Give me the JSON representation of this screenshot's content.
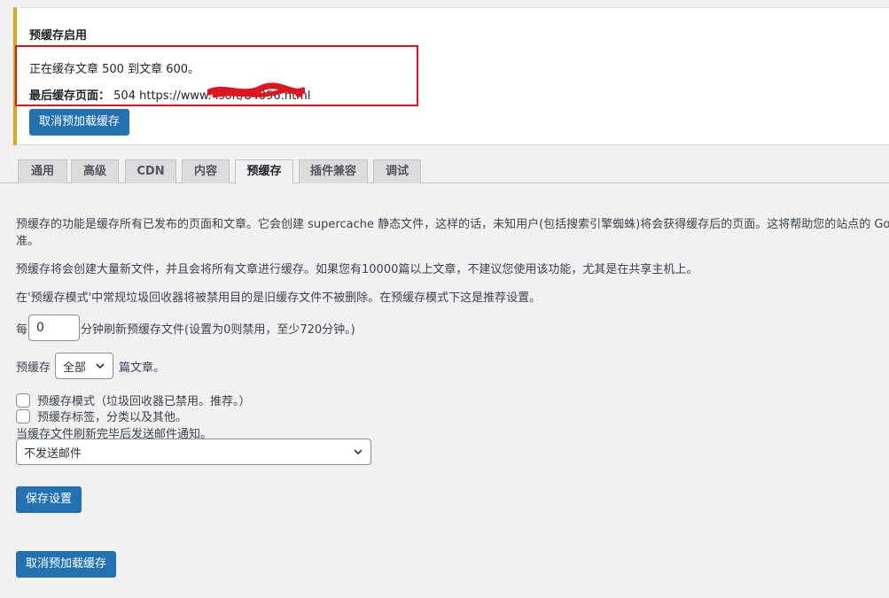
{
  "notice": {
    "title": "预缓存启用",
    "line1": "正在缓存文章 500 到文章 600。",
    "last_label": "最后缓存页面：",
    "last_value": "504 https://www.                  .soft/84096.html",
    "cancel_button": "取消预加载缓存"
  },
  "tabs": [
    "通用",
    "高级",
    "CDN",
    "内容",
    "预缓存",
    "插件兼容",
    "调试"
  ],
  "active_tab": "预缓存",
  "paragraphs": {
    "p1a": "预缓存的功能是缓存所有已发布的页面和文章。它会创建 supercache 静态文件，这样的话，未知用户(包括搜索引擎蜘蛛)将会获得缓存后的页面。这将帮助您的站点的 Goo",
    "p1b": "准。",
    "p2": "预缓存将会创建大量新文件，并且会将所有文章进行缓存。如果您有10000篇以上文章，不建议您使用该功能，尤其是在共享主机上。",
    "p3": "在'预缓存模式'中常规垃圾回收器将被禁用目的是旧缓存文件不被删除。在预缓存模式下这是推荐设置。"
  },
  "refresh": {
    "prefix": "每",
    "value": "0",
    "suffix": "分钟刷新预缓存文件(设置为0则禁用，至少720分钟。)"
  },
  "posts": {
    "prefix": "预缓存",
    "selected": "全部",
    "suffix": "篇文章。"
  },
  "checkboxes": {
    "mode": "预缓存模式（垃圾回收器已禁用。推荐。）",
    "tags": "预缓存标签，分类以及其他。"
  },
  "email": {
    "label": "当缓存文件刷新完毕后发送邮件通知。",
    "selected": "不发送邮件"
  },
  "buttons": {
    "save": "保存设置",
    "cancel": "取消预加载缓存"
  },
  "colors": {
    "primary": "#2271b1",
    "warning": "#dba617",
    "highlight": "#e0141e"
  }
}
